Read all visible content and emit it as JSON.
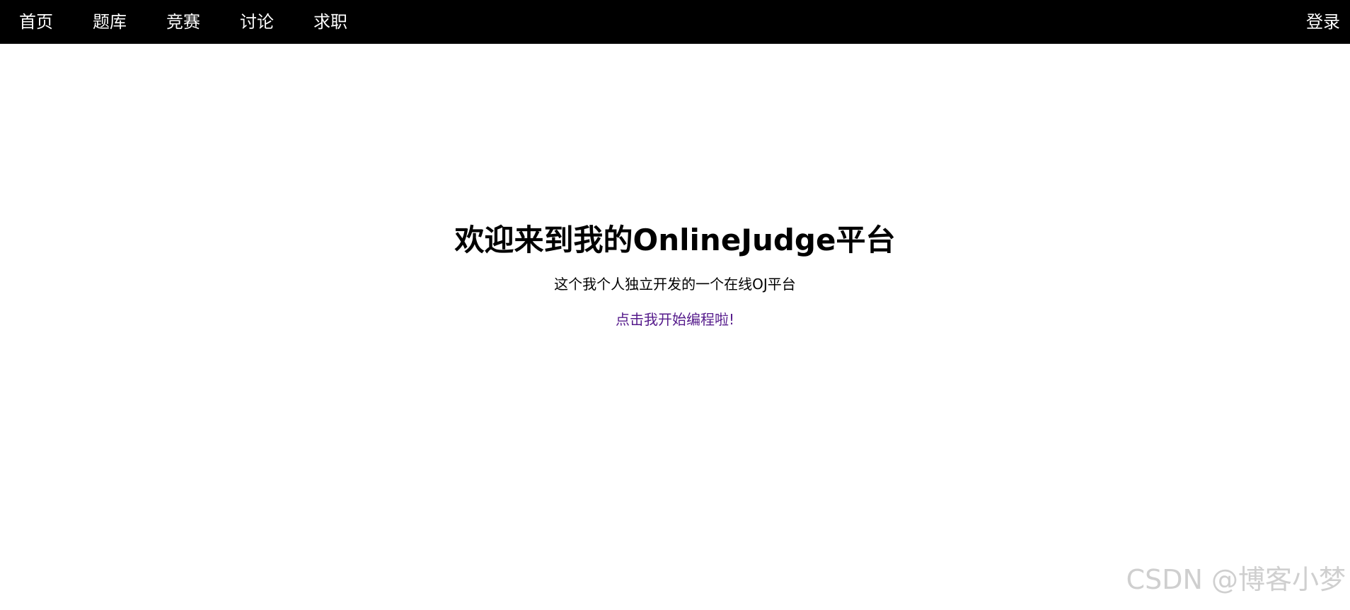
{
  "navbar": {
    "items": [
      {
        "label": "首页"
      },
      {
        "label": "题库"
      },
      {
        "label": "竞赛"
      },
      {
        "label": "讨论"
      },
      {
        "label": "求职"
      }
    ],
    "login_label": "登录"
  },
  "hero": {
    "title": "欢迎来到我的OnlineJudge平台",
    "subtitle": "这个我个人独立开发的一个在线OJ平台",
    "link_label": "点击我开始编程啦!"
  },
  "watermark": {
    "text": "CSDN @博客小梦"
  },
  "colors": {
    "navbar_bg": "#000000",
    "nav_text": "#ffffff",
    "link": "#551a8b",
    "watermark": "#cfcfcf"
  }
}
